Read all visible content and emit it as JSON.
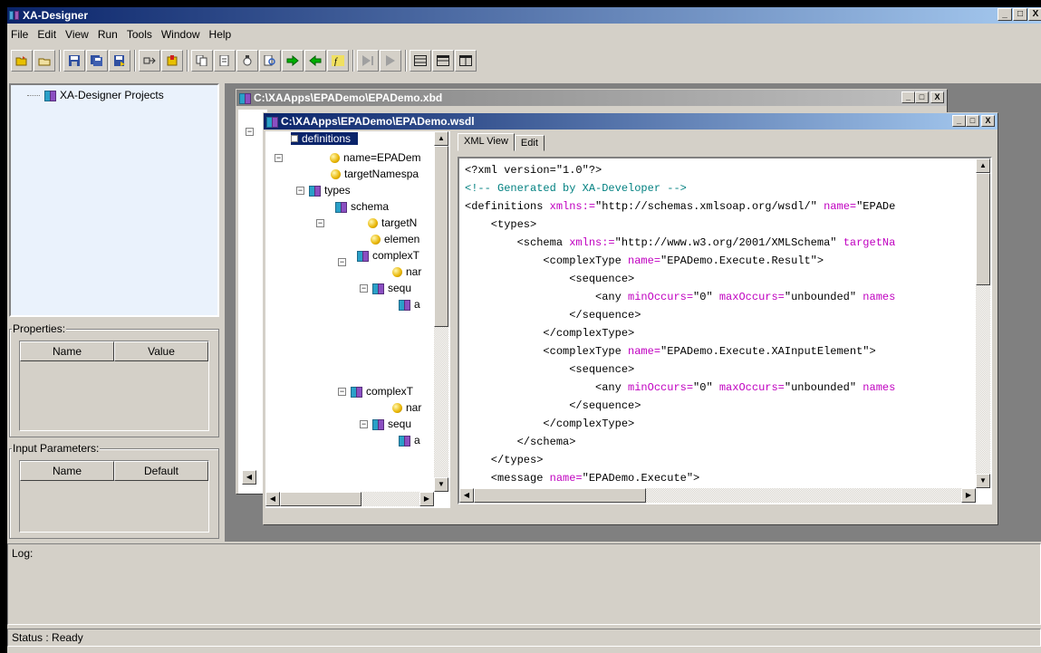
{
  "app": {
    "title": "XA-Designer"
  },
  "window_buttons": {
    "min": "_",
    "max": "□",
    "close": "X"
  },
  "menu": [
    "File",
    "Edit",
    "View",
    "Run",
    "Tools",
    "Window",
    "Help"
  ],
  "toolbar": {
    "icons": [
      "open-folder-icon",
      "open-icon",
      "save-icon",
      "save-all-icon",
      "save-as-icon",
      "connect-icon",
      "import-icon",
      "copy-icon",
      "paste-icon",
      "settings-icon",
      "search-icon",
      "forward-arrow-icon",
      "back-arrow-icon",
      "function-icon",
      "run-step-icon",
      "run-icon",
      "cascade-icon",
      "tile-horizontal-icon",
      "tile-vertical-icon"
    ],
    "colors": {
      "green": "#00b000",
      "yellow": "#e8c000",
      "gray": "#a0a0a0"
    }
  },
  "left": {
    "projects_root": "XA-Designer Projects",
    "properties": {
      "label": "Properties:",
      "columns": [
        "Name",
        "Value"
      ]
    },
    "input_params": {
      "label": "Input Parameters:",
      "columns": [
        "Name",
        "Default"
      ]
    }
  },
  "log": {
    "label": "Log:"
  },
  "status": {
    "text": "Status : Ready"
  },
  "child_xbd": {
    "title": "C:\\XAApps\\EPADemo\\EPADemo.xbd"
  },
  "child_wsdl": {
    "title": "C:\\XAApps\\EPADemo\\EPADemo.wsdl",
    "tree": [
      "definitions",
      "name=EPADem",
      "targetNamespa",
      "types",
      "schema",
      "targetN",
      "elemen",
      "complexT",
      "nar",
      "sequ",
      "a",
      "complexT",
      "nar",
      "sequ",
      "a"
    ],
    "tabs": [
      "XML View",
      "Edit"
    ],
    "xml": [
      {
        "t": "<?xml version=\"1.0\"?>"
      },
      {
        "t": "<!-- Generated by XA-Developer -->",
        "cls": "c"
      },
      {
        "p": "<definitions ",
        "a": "xmlns:=",
        "v": "\"http://schemas.xmlsoap.org/wsdl/\" ",
        "a2": "name=",
        "v2": "\"EPADe"
      },
      {
        "t": "    <types>"
      },
      {
        "p": "        <schema ",
        "a": "xmlns:=",
        "v": "\"http://www.w3.org/2001/XMLSchema\" ",
        "a2": "targetNa"
      },
      {
        "p": "            <complexType ",
        "a": "name=",
        "v": "\"EPADemo.Execute.Result\">"
      },
      {
        "t": "                <sequence>"
      },
      {
        "p": "                    <any ",
        "a": "minOccurs=",
        "v": "\"0\" ",
        "a2": "maxOccurs=",
        "v2": "\"unbounded\" ",
        "a3": "names"
      },
      {
        "t": "                </sequence>"
      },
      {
        "t": "            </complexType>"
      },
      {
        "p": "            <complexType ",
        "a": "name=",
        "v": "\"EPADemo.Execute.XAInputElement\">"
      },
      {
        "t": "                <sequence>"
      },
      {
        "p": "                    <any ",
        "a": "minOccurs=",
        "v": "\"0\" ",
        "a2": "maxOccurs=",
        "v2": "\"unbounded\" ",
        "a3": "names"
      },
      {
        "t": "                </sequence>"
      },
      {
        "t": "            </complexType>"
      },
      {
        "t": "        </schema>"
      },
      {
        "t": "    </types>"
      },
      {
        "p": "    <message ",
        "a": "name=",
        "v": "\"EPADemo.Execute\">"
      }
    ]
  }
}
